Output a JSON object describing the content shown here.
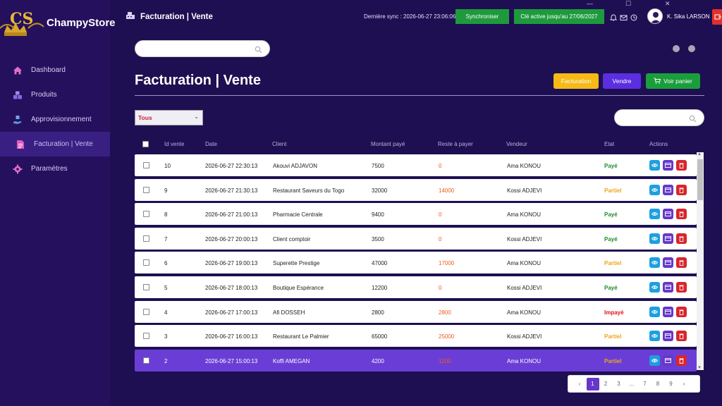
{
  "app": {
    "name": "ChampyStore"
  },
  "window": {
    "minimize": "—",
    "maximize": "☐",
    "close": "✕"
  },
  "sidebar": {
    "items": [
      {
        "label": "Dashboard",
        "icon": "home-icon"
      },
      {
        "label": "Produits",
        "icon": "boxes-icon"
      },
      {
        "label": "Approvisionnement",
        "icon": "hand-box-icon"
      },
      {
        "label": "Facturation | Vente",
        "icon": "invoice-icon",
        "active": true
      },
      {
        "label": "Paramètres",
        "icon": "gear-icon"
      }
    ]
  },
  "header": {
    "breadcrumb": "Facturation | Vente",
    "sync_text": "Dernière sync : 2026-06-27 23:06:06",
    "sync_button": "Synchroniser",
    "key_button": "Clé active jusqu'au 27/06/2027",
    "user_name": "K. Sika LARSON"
  },
  "main": {
    "title": "Facturation | Vente",
    "buttons": {
      "facturation": "Facturation",
      "vendre": "Vendre",
      "panier": "Voir panier"
    },
    "filter": {
      "selected": "Tous"
    },
    "search_top": {
      "placeholder": ""
    },
    "search_table": {
      "placeholder": ""
    }
  },
  "table": {
    "columns": [
      "Id vente",
      "Date",
      "Client",
      "Montant payé",
      "Reste à payer",
      "Vendeur",
      "Etat",
      "Actions"
    ],
    "rows": [
      {
        "id": "10",
        "date": "2026-06-27 22:30:13",
        "client": "Akouvi ADJAVON",
        "montant": "7500",
        "reste": "0",
        "vendeur": "Ama KONOU",
        "etat": "Payé",
        "etat_class": "etat-paye"
      },
      {
        "id": "9",
        "date": "2026-06-27 21:30:13",
        "client": "Restaurant Saveurs du Togo",
        "montant": "32000",
        "reste": "14000",
        "vendeur": "Kossi ADJEVI",
        "etat": "Partiel",
        "etat_class": "etat-partiel"
      },
      {
        "id": "8",
        "date": "2026-06-27 21:00:13",
        "client": "Pharmacie Centrale",
        "montant": "9400",
        "reste": "0",
        "vendeur": "Ama KONOU",
        "etat": "Payé",
        "etat_class": "etat-paye"
      },
      {
        "id": "7",
        "date": "2026-06-27 20:00:13",
        "client": "Client comptoir",
        "montant": "3500",
        "reste": "0",
        "vendeur": "Kossi ADJEVI",
        "etat": "Payé",
        "etat_class": "etat-paye"
      },
      {
        "id": "6",
        "date": "2026-06-27 19:00:13",
        "client": "Superette Prestige",
        "montant": "47000",
        "reste": "17000",
        "vendeur": "Ama KONOU",
        "etat": "Partiel",
        "etat_class": "etat-partiel"
      },
      {
        "id": "5",
        "date": "2026-06-27 18:00:13",
        "client": "Boutique Espérance",
        "montant": "12200",
        "reste": "0",
        "vendeur": "Kossi ADJEVI",
        "etat": "Payé",
        "etat_class": "etat-paye"
      },
      {
        "id": "4",
        "date": "2026-06-27 17:00:13",
        "client": "Afi DOSSEH",
        "montant": "2800",
        "reste": "2800",
        "vendeur": "Ama KONOU",
        "etat": "Impayé",
        "etat_class": "etat-impaye"
      },
      {
        "id": "3",
        "date": "2026-06-27 16:00:13",
        "client": "Restaurant Le Palmier",
        "montant": "65000",
        "reste": "25000",
        "vendeur": "Kossi ADJEVI",
        "etat": "Partiel",
        "etat_class": "etat-partiel"
      },
      {
        "id": "2",
        "date": "2026-06-27 15:00:13",
        "client": "Koffi AMEGAN",
        "montant": "4200",
        "reste": "1200",
        "vendeur": "Ama KONOU",
        "etat": "Partiel",
        "etat_class": "etat-partiel",
        "selected": true
      }
    ]
  },
  "pagination": {
    "prev": "‹",
    "next": "›",
    "pages": [
      "1",
      "2",
      "3",
      "...",
      "7",
      "8",
      "9"
    ],
    "current": "1"
  },
  "colors": {
    "background": "#1e0f52",
    "sidebar": "#25105e",
    "accent": "#6538c9",
    "green": "#1e9a3d"
  }
}
